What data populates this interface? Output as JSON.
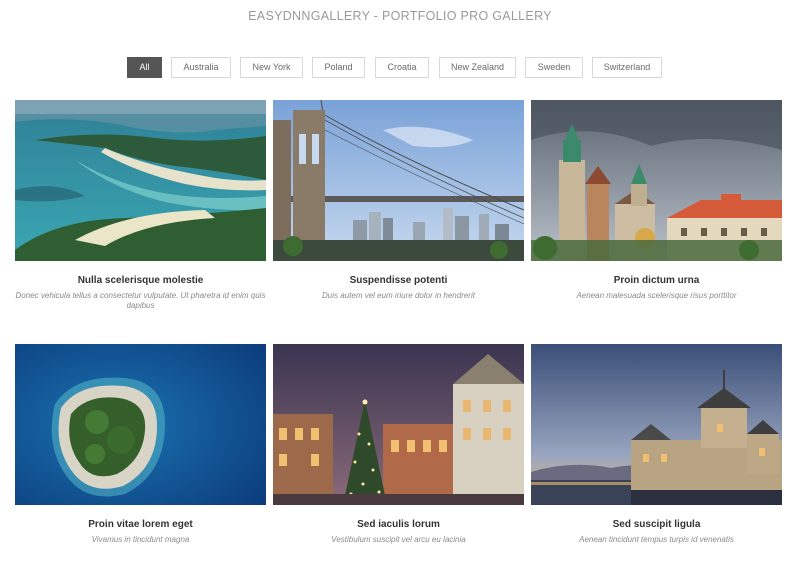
{
  "gallery": {
    "title": "EASYDNNGALLERY - PORTFOLIO PRO GALLERY"
  },
  "filters": [
    {
      "label": "All",
      "active": true
    },
    {
      "label": "Australia",
      "active": false
    },
    {
      "label": "New York",
      "active": false
    },
    {
      "label": "Poland",
      "active": false
    },
    {
      "label": "Croatia",
      "active": false
    },
    {
      "label": "New Zealand",
      "active": false
    },
    {
      "label": "Sweden",
      "active": false
    },
    {
      "label": "Switzerland",
      "active": false
    }
  ],
  "items": [
    {
      "title": "Nulla scelerisque molestie",
      "description": "Donec vehicula tellus a consectetur vulputate. Ut pharetra id enim quis dapibus",
      "image": "tropical-beach-aerial"
    },
    {
      "title": "Suspendisse potenti",
      "description": "Duis autem vel eum iriure dolor in hendrerit",
      "image": "suspension-bridge-skyline"
    },
    {
      "title": "Proin dictum urna",
      "description": "Aenean malesuada scelerisque risus porttitor",
      "image": "castle-cathedral-towers"
    },
    {
      "title": "Proin vitae lorem eget",
      "description": "Vivamus in tincidunt magna",
      "image": "island-in-blue-sea"
    },
    {
      "title": "Sed iaculis lorum",
      "description": "Vestibulum suscipit vel arcu eu lacinia",
      "image": "christmas-tree-square"
    },
    {
      "title": "Sed suscipit ligula",
      "description": "Aenean tincidunt tempus turpis id venenatis",
      "image": "lakeside-castle-dusk"
    }
  ]
}
